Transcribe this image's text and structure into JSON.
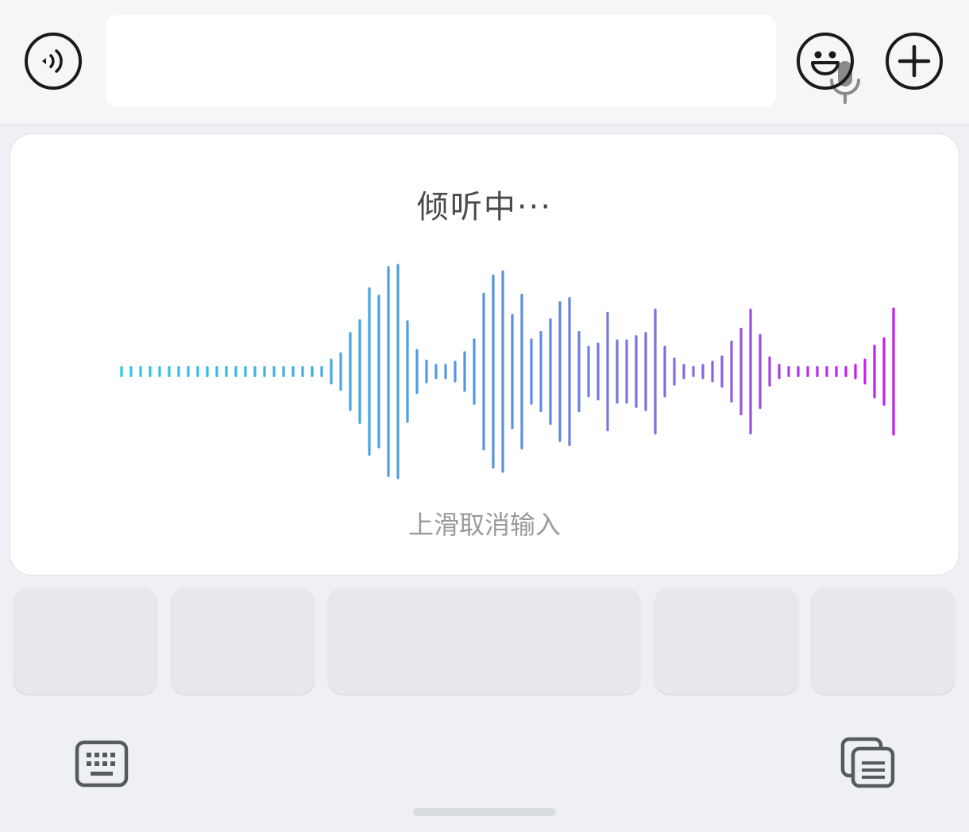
{
  "top_bar": {
    "text_input": {
      "value": "",
      "placeholder": ""
    }
  },
  "voice_panel": {
    "status": "倾听中···",
    "hint": "上滑取消输入",
    "wave_amplitudes": [
      0.04,
      0.04,
      0.04,
      0.04,
      0.04,
      0.04,
      0.04,
      0.04,
      0.04,
      0.04,
      0.04,
      0.04,
      0.04,
      0.04,
      0.04,
      0.04,
      0.04,
      0.04,
      0.04,
      0.04,
      0.04,
      0.04,
      0.11,
      0.17,
      0.36,
      0.48,
      0.78,
      0.71,
      0.98,
      1.0,
      0.47,
      0.2,
      0.1,
      0.06,
      0.06,
      0.09,
      0.18,
      0.3,
      0.73,
      0.9,
      0.94,
      0.53,
      0.72,
      0.3,
      0.37,
      0.49,
      0.65,
      0.69,
      0.37,
      0.23,
      0.26,
      0.55,
      0.29,
      0.29,
      0.33,
      0.36,
      0.58,
      0.23,
      0.12,
      0.06,
      0.04,
      0.06,
      0.09,
      0.14,
      0.28,
      0.4,
      0.58,
      0.34,
      0.13,
      0.06,
      0.04,
      0.04,
      0.04,
      0.04,
      0.04,
      0.04,
      0.04,
      0.06,
      0.11,
      0.24,
      0.31,
      0.59
    ],
    "wave_gradient": [
      "#2ec4ec",
      "#5b8fdf",
      "#8e5fe0",
      "#c21ef0"
    ]
  },
  "keys": [
    {
      "label": ""
    },
    {
      "label": ""
    },
    {
      "label": ""
    },
    {
      "label": ""
    },
    {
      "label": ""
    }
  ],
  "icons": {
    "voice_toggle": "sound-wave-icon",
    "input_mic": "microphone-icon",
    "emoji": "smiley-icon",
    "plus": "plus-icon",
    "keyboard": "keyboard-icon",
    "clipboard": "clipboard-icon"
  }
}
